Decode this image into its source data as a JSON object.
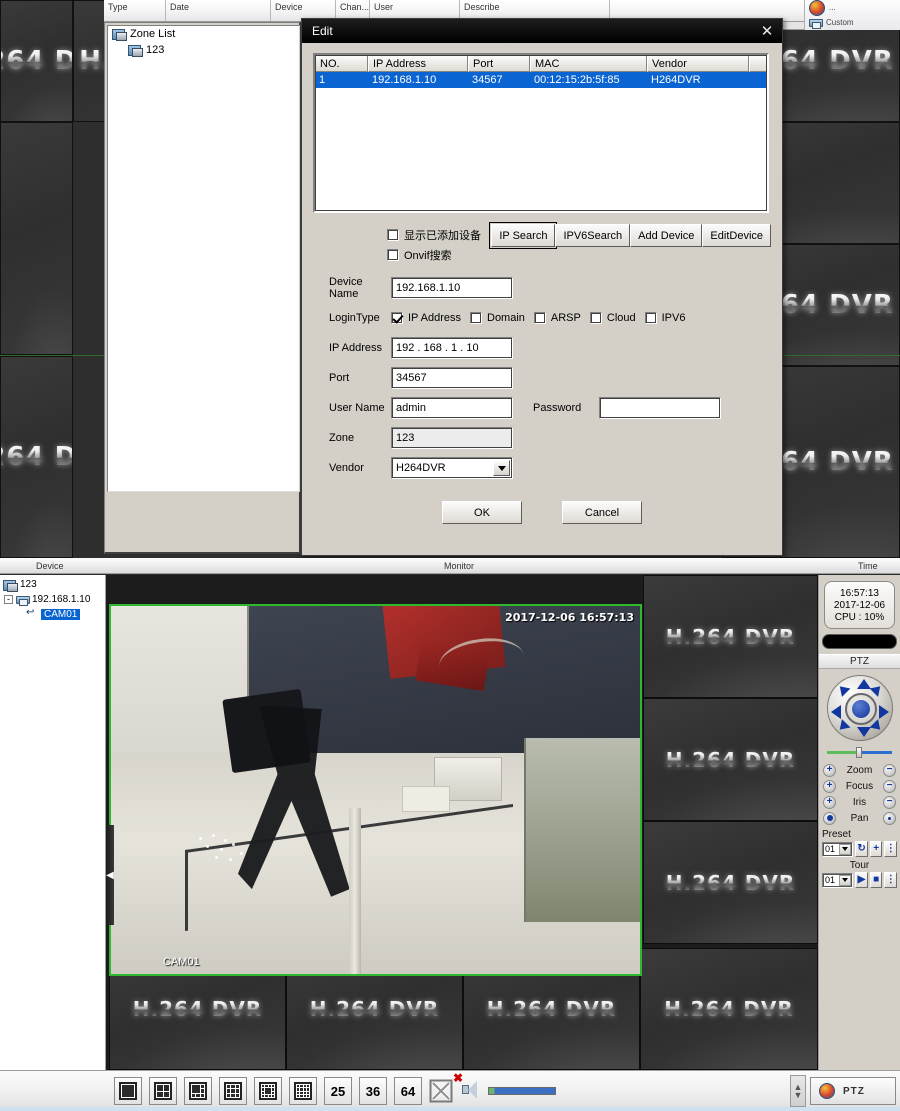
{
  "log_header": {
    "columns": [
      "Type",
      "Date",
      "Device",
      "Chan...",
      "User",
      "Describe",
      ""
    ]
  },
  "tray": {
    "item1": "...",
    "item2": "Custom"
  },
  "zone_panel": {
    "title": "Zone List",
    "items": [
      {
        "label": "Zone List",
        "icon": "zone-icon",
        "level": 0
      },
      {
        "label": "123",
        "icon": "zone-icon",
        "level": 1
      }
    ]
  },
  "dialog": {
    "title": "Edit",
    "close_icon": "close-icon",
    "grid": {
      "headers": [
        "NO.",
        "IP Address",
        "Port",
        "MAC",
        "Vendor"
      ],
      "rows": [
        {
          "no": "1",
          "ip": "192.168.1.10",
          "port": "34567",
          "mac": "00:12:15:2b:5f:85",
          "vendor": "H264DVR"
        }
      ]
    },
    "checkboxes": [
      {
        "label": "显示已添加设备",
        "checked": false
      },
      {
        "label": "Onvif搜索",
        "checked": false
      }
    ],
    "buttons": {
      "ip_search": "IP Search",
      "ipv6_search": "IPV6Search",
      "add_device": "Add Device",
      "edit_device": "EditDevice",
      "ok": "OK",
      "cancel": "Cancel"
    },
    "fields": {
      "device_name_label": "Device Name",
      "device_name_value": "192.168.1.10",
      "logintype_label": "LoginType",
      "ip_address_label": "IP Address",
      "ip_address_value": "192 . 168 .  1   . 10",
      "port_label": "Port",
      "port_value": "34567",
      "user_name_label": "User Name",
      "user_name_value": "admin",
      "password_label": "Password",
      "password_value": "",
      "zone_label": "Zone",
      "zone_value": "123",
      "vendor_label": "Vendor",
      "vendor_value": "H264DVR"
    },
    "logintype_options": [
      {
        "label": "IP Address",
        "checked": true
      },
      {
        "label": "Domain",
        "checked": false
      },
      {
        "label": "ARSP",
        "checked": false
      },
      {
        "label": "Cloud",
        "checked": false
      },
      {
        "label": "IPV6",
        "checked": false
      }
    ]
  },
  "splitbar": {
    "device": "Device",
    "monitor": "Monitor",
    "time": "Time"
  },
  "device_tree": [
    {
      "label": "123",
      "level": 0,
      "icon": "zone-icon",
      "expander": "",
      "selected": false
    },
    {
      "label": "192.168.1.10",
      "level": 1,
      "icon": "device-icon",
      "expander": "-",
      "selected": false
    },
    {
      "label": "CAM01",
      "level": 2,
      "icon": "camera-icon",
      "expander": "",
      "selected": true
    }
  ],
  "monitor": {
    "live": {
      "timestamp": "2017-12-06 16:57:13",
      "channel_name": "CAM01"
    },
    "placeholder_text": "H.264 DVR",
    "placeholder_count": 7,
    "selection_color": "#2eb82e"
  },
  "background_wall": {
    "placeholder_text": "H.264 DVR"
  },
  "right_panel": {
    "clock": {
      "time": "16:57:13",
      "date": "2017-12-06",
      "cpu": "CPU : 10%"
    },
    "ptz_title": "PTZ",
    "controls": [
      {
        "label": "Zoom",
        "minus": "−",
        "plus": "+"
      },
      {
        "label": "Focus",
        "minus": "−",
        "plus": "+"
      },
      {
        "label": "Iris",
        "minus": "−",
        "plus": "+"
      },
      {
        "label": "Pan",
        "minus": "•",
        "plus": "•"
      }
    ],
    "preset_label": "Preset",
    "preset_value": "01",
    "tour_label": "Tour",
    "tour_value": "01"
  },
  "bottom_toolbar": {
    "layout_buttons": [
      {
        "name": "layout-1",
        "type": "grid",
        "cols": 1,
        "label": ""
      },
      {
        "name": "layout-4",
        "type": "grid",
        "cols": 2,
        "label": ""
      },
      {
        "name": "layout-6",
        "type": "grid",
        "cols": 3,
        "label": ""
      },
      {
        "name": "layout-9",
        "type": "grid",
        "cols": 3,
        "label": ""
      },
      {
        "name": "layout-13",
        "type": "grid",
        "cols": 4,
        "label": ""
      },
      {
        "name": "layout-16",
        "type": "grid",
        "cols": 4,
        "label": ""
      },
      {
        "name": "layout-25",
        "type": "text",
        "cols": 0,
        "label": "25"
      },
      {
        "name": "layout-36",
        "type": "text",
        "cols": 0,
        "label": "36"
      },
      {
        "name": "layout-64",
        "type": "text",
        "cols": 0,
        "label": "64"
      },
      {
        "name": "fullscreen",
        "type": "icon",
        "cols": 0,
        "label": ""
      }
    ],
    "mute_icon": "speaker-mute-icon",
    "volume_level": "8",
    "ptz_tab_label": "PTZ"
  },
  "colors": {
    "accent_blue": "#0a64d2",
    "selection_green": "#2eb82e",
    "dialog_face": "#d4d0c8",
    "titlebar": "#000000"
  }
}
